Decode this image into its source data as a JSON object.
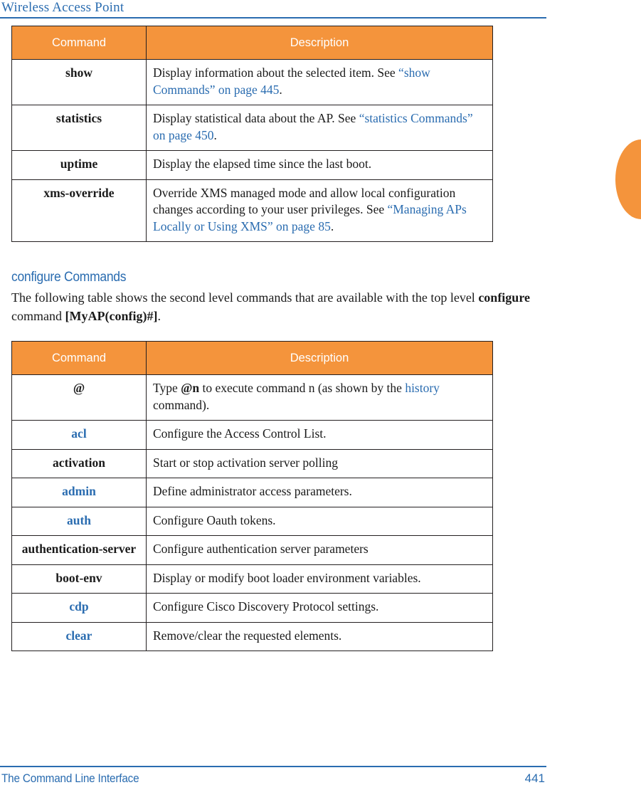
{
  "header": {
    "title": "Wireless Access Point"
  },
  "footer": {
    "section": "The Command Line Interface",
    "page_number": "441"
  },
  "colors": {
    "accent_orange": "#f4943c",
    "link_blue": "#2a6cb0",
    "border": "#231f20",
    "text": "#1a1a1a"
  },
  "tables": [
    {
      "headers": {
        "command": "Command",
        "description": "Description"
      },
      "rows": [
        {
          "command": "show",
          "command_style": "bold",
          "desc_parts": [
            {
              "text": "Display information about the selected item. See ",
              "style": "plain"
            },
            {
              "text": "“show Commands” on page 445",
              "style": "link"
            },
            {
              "text": ".",
              "style": "plain"
            }
          ]
        },
        {
          "command": "statistics",
          "command_style": "bold",
          "desc_parts": [
            {
              "text": "Display statistical data about the AP. See ",
              "style": "plain"
            },
            {
              "text": "“statistics Commands” on page 450",
              "style": "link"
            },
            {
              "text": ".",
              "style": "plain"
            }
          ]
        },
        {
          "command": "uptime",
          "command_style": "bold",
          "desc_parts": [
            {
              "text": "Display the elapsed time since the last boot.",
              "style": "plain"
            }
          ]
        },
        {
          "command": "xms-override",
          "command_style": "bold",
          "desc_parts": [
            {
              "text": "Override XMS managed mode and allow local configuration changes according to your user privileges. See ",
              "style": "plain"
            },
            {
              "text": "“Managing APs Locally or Using XMS” on page 85",
              "style": "link"
            },
            {
              "text": ".",
              "style": "plain"
            }
          ]
        }
      ]
    },
    {
      "headers": {
        "command": "Command",
        "description": "Description"
      },
      "rows": [
        {
          "command": "@",
          "command_style": "plain",
          "desc_parts": [
            {
              "text": "Type ",
              "style": "plain"
            },
            {
              "text": "@n",
              "style": "bold"
            },
            {
              "text": " to execute command n (as shown by the ",
              "style": "plain"
            },
            {
              "text": "history",
              "style": "link"
            },
            {
              "text": " command).",
              "style": "plain"
            }
          ]
        },
        {
          "command": "acl",
          "command_style": "link",
          "desc_parts": [
            {
              "text": "Configure the Access Control List.",
              "style": "plain"
            }
          ]
        },
        {
          "command": "activation",
          "command_style": "bold",
          "desc_parts": [
            {
              "text": "Start or stop activation server polling",
              "style": "plain"
            }
          ]
        },
        {
          "command": "admin",
          "command_style": "link",
          "desc_parts": [
            {
              "text": "Define administrator access parameters.",
              "style": "plain"
            }
          ]
        },
        {
          "command": "auth",
          "command_style": "link",
          "desc_parts": [
            {
              "text": " Configure Oauth tokens.",
              "style": "plain"
            }
          ]
        },
        {
          "command": "authentication-server",
          "command_style": "bold",
          "desc_parts": [
            {
              "text": "Configure authentication server parameters",
              "style": "plain"
            }
          ]
        },
        {
          "command": "boot-env",
          "command_style": "bold",
          "desc_parts": [
            {
              "text": "Display or modify boot loader environment variables.",
              "style": "plain"
            }
          ]
        },
        {
          "command": "cdp",
          "command_style": "link",
          "desc_parts": [
            {
              "text": " Configure Cisco Discovery Protocol settings.",
              "style": "plain"
            }
          ]
        },
        {
          "command": "clear",
          "command_style": "link",
          "desc_parts": [
            {
              "text": "Remove/clear the requested elements.",
              "style": "plain"
            }
          ]
        }
      ]
    }
  ],
  "section": {
    "heading": "configure Commands",
    "paragraph_parts": [
      {
        "text": "The following table shows the second level commands that are available with the top level ",
        "style": "plain"
      },
      {
        "text": "configure",
        "style": "bold"
      },
      {
        "text": " command ",
        "style": "plain"
      },
      {
        "text": "[MyAP(config)#]",
        "style": "bold"
      },
      {
        "text": ".",
        "style": "plain"
      }
    ]
  }
}
